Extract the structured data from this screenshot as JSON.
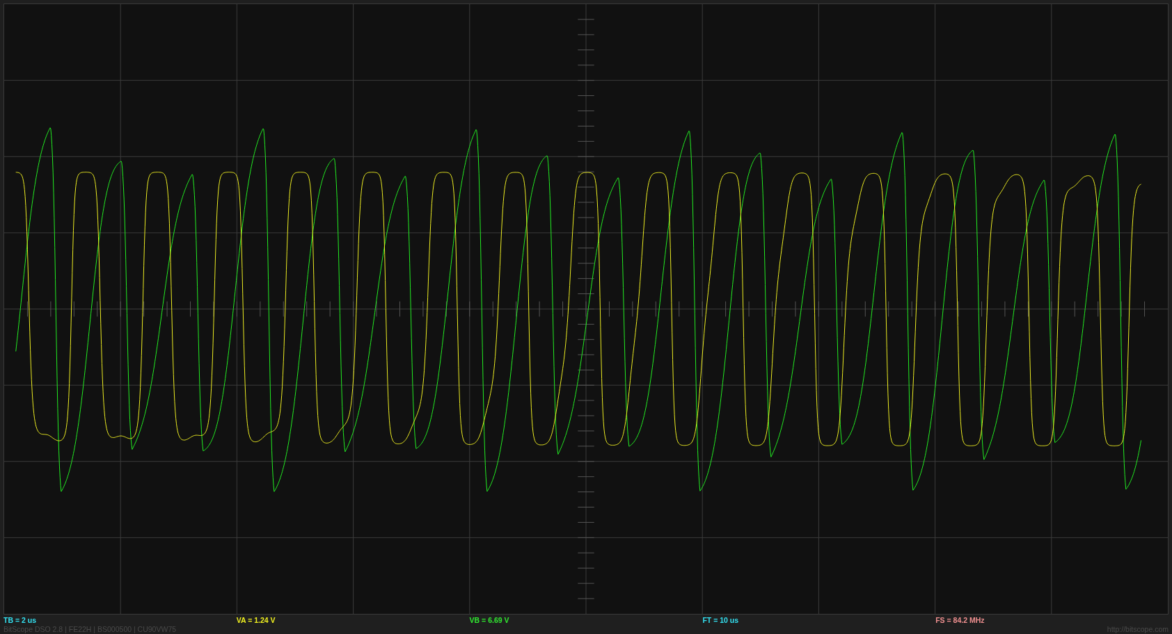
{
  "readouts": [
    {
      "label": "TB = 2 us",
      "color": "#33e0f0"
    },
    {
      "label": "VA = 1.24 V",
      "color": "#f0f020"
    },
    {
      "label": "VB = 6.69 V",
      "color": "#30e830"
    },
    {
      "label": "FT = 10 us",
      "color": "#33e0f0"
    },
    {
      "label": "FS = 84.2 MHz",
      "color": "#f09090"
    }
  ],
  "footer": {
    "version": "BitScope DSO 2.8 | FE22H | BS000500 | CU90VW75",
    "url": "http://bitscope.com"
  }
}
